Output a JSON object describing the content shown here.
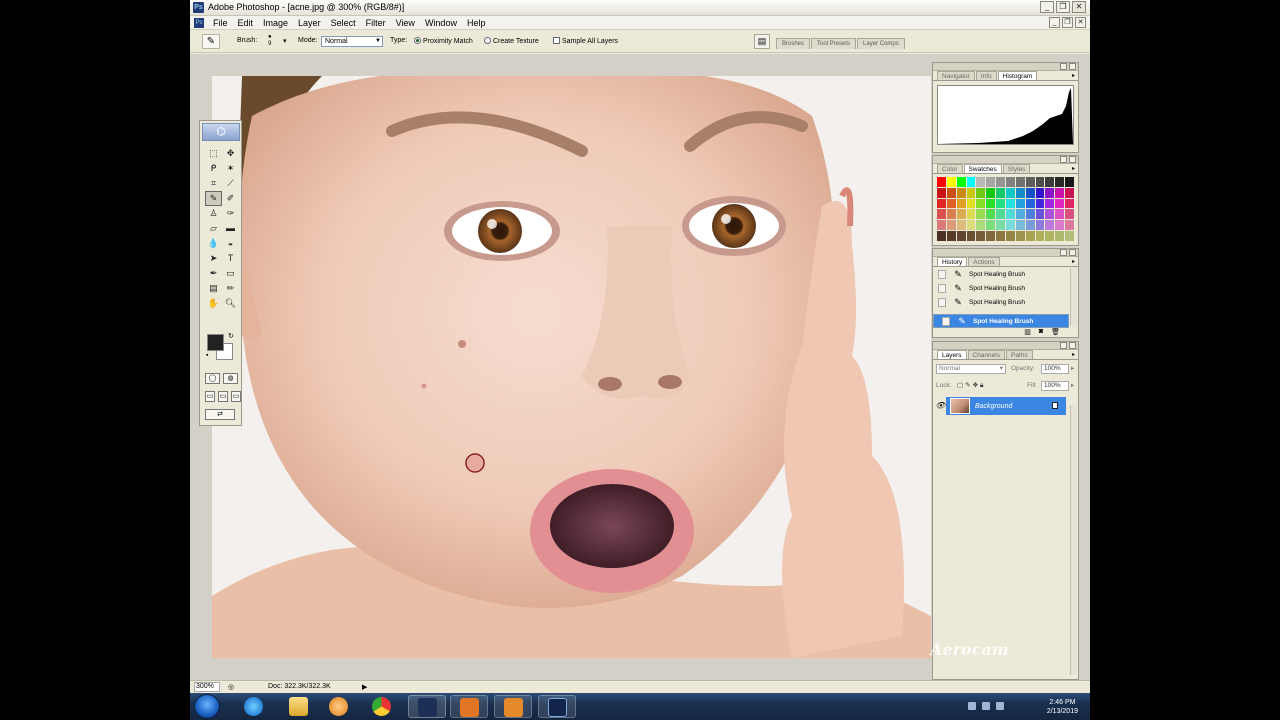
{
  "window": {
    "title": "Adobe Photoshop - [acne.jpg @ 300% (RGB/8#)]"
  },
  "menu": [
    "File",
    "Edit",
    "Image",
    "Layer",
    "Select",
    "Filter",
    "View",
    "Window",
    "Help"
  ],
  "options_bar": {
    "brush_label": "Brush:",
    "brush_size": "9",
    "mode_label": "Mode:",
    "mode_value": "Normal",
    "type_label": "Type:",
    "proximity_match": "Proximity Match",
    "create_texture": "Create Texture",
    "sample_all_layers": "Sample All Layers",
    "well_tabs": [
      "Brushes",
      "Tool Presets",
      "Layer Comps"
    ]
  },
  "panels": {
    "navigator": {
      "tabs": [
        "Navigator",
        "Info",
        "Histogram"
      ],
      "active": "Histogram"
    },
    "color": {
      "tabs": [
        "Color",
        "Swatches",
        "Styles"
      ],
      "active": "Swatches"
    },
    "history": {
      "tabs": [
        "History",
        "Actions"
      ],
      "active": "History",
      "items": [
        "Spot Healing Brush",
        "Spot Healing Brush",
        "Spot Healing Brush",
        "Spot Healing Brush"
      ]
    },
    "layers": {
      "tabs": [
        "Layers",
        "Channels",
        "Paths"
      ],
      "active": "Layers",
      "blend_mode": "Normal",
      "opacity_label": "Opacity:",
      "opacity": "100%",
      "lock_label": "Lock:",
      "fill_label": "Fill:",
      "fill": "100%",
      "layer_name": "Background"
    }
  },
  "status": {
    "zoom": "300%",
    "doc": "Doc: 322.3K/322.3K"
  },
  "taskbar": {
    "time": "2:46 PM",
    "date": "2/13/2019"
  },
  "watermark": "Aerocam"
}
